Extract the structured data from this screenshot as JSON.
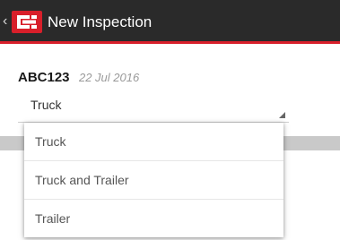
{
  "appbar": {
    "title": "New Inspection",
    "back_icon": "chevron-left-icon",
    "logo_icon": "brand-logo-icon",
    "background": "#2a2a2a",
    "accent": "#d81f2a"
  },
  "record": {
    "registration": "ABC123",
    "date": "22 Jul 2016"
  },
  "vehicle_type": {
    "selected": "Truck",
    "options": [
      "Truck",
      "Truck and Trailer",
      "Trailer"
    ]
  }
}
